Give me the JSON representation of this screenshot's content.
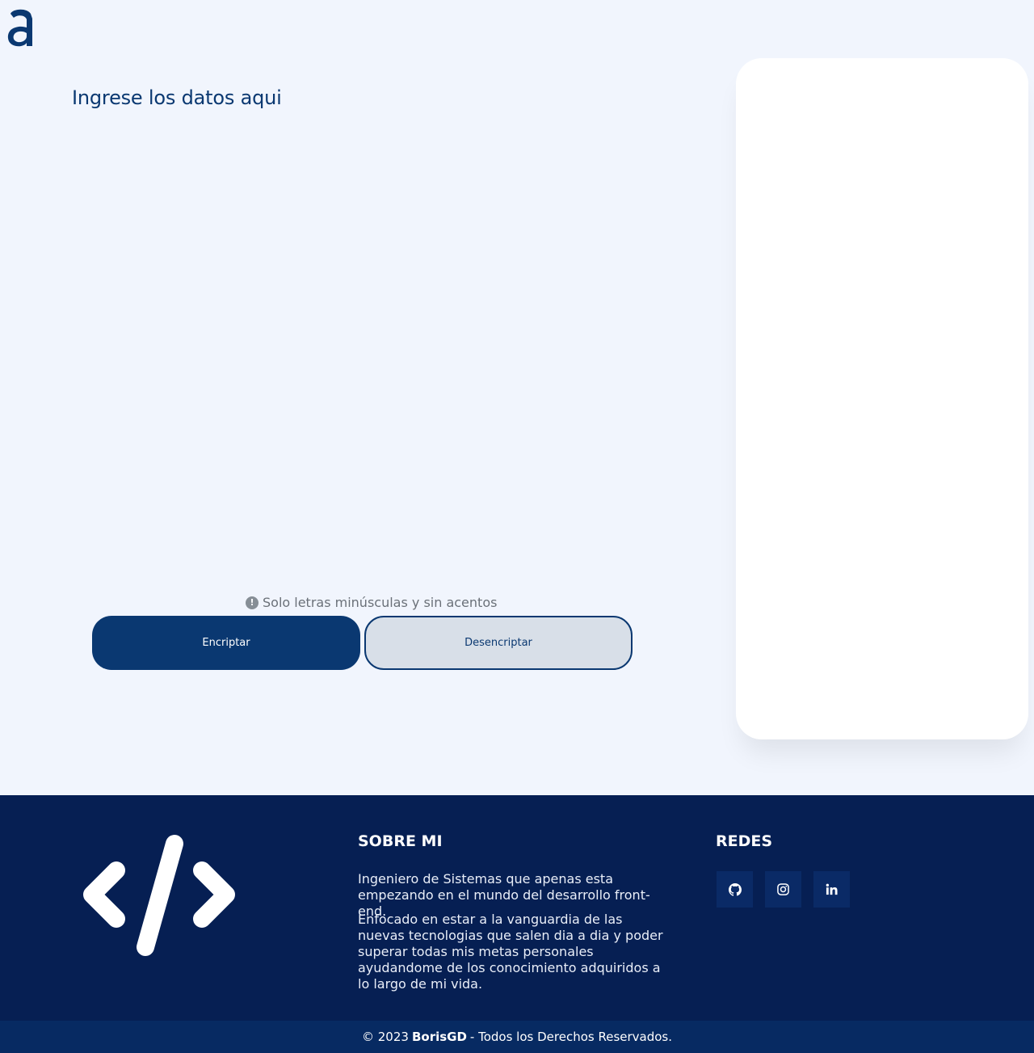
{
  "main": {
    "title": "Ingrese los datos aqui",
    "input_value": "",
    "hint": "Solo letras minúsculas y sin acentos",
    "encrypt_label": "Encriptar",
    "decrypt_label": "Desencriptar"
  },
  "footer": {
    "about_title": "SOBRE MI",
    "about_p1": "Ingeniero de Sistemas que apenas esta empezando en el mundo del desarrollo front-end.",
    "about_p2": "Enfocado en estar a la vanguardia de las nuevas tecnologias que salen dia a dia y poder superar todas mis metas personales ayudandome de los conocimiento adquiridos a lo largo de mi vida.",
    "social_title": "REDES",
    "social_icons": [
      "github-icon",
      "instagram-icon",
      "linkedin-icon"
    ]
  },
  "copyright": {
    "prefix": "© 2023",
    "author": "BorisGD",
    "suffix": "- Todos los Derechos Reservados."
  },
  "colors": {
    "primary": "#0a3871",
    "background": "#f1f5fd",
    "footer": "#061f53",
    "copyright_bar": "#072a62",
    "secondary_button": "#d8dfe8"
  }
}
